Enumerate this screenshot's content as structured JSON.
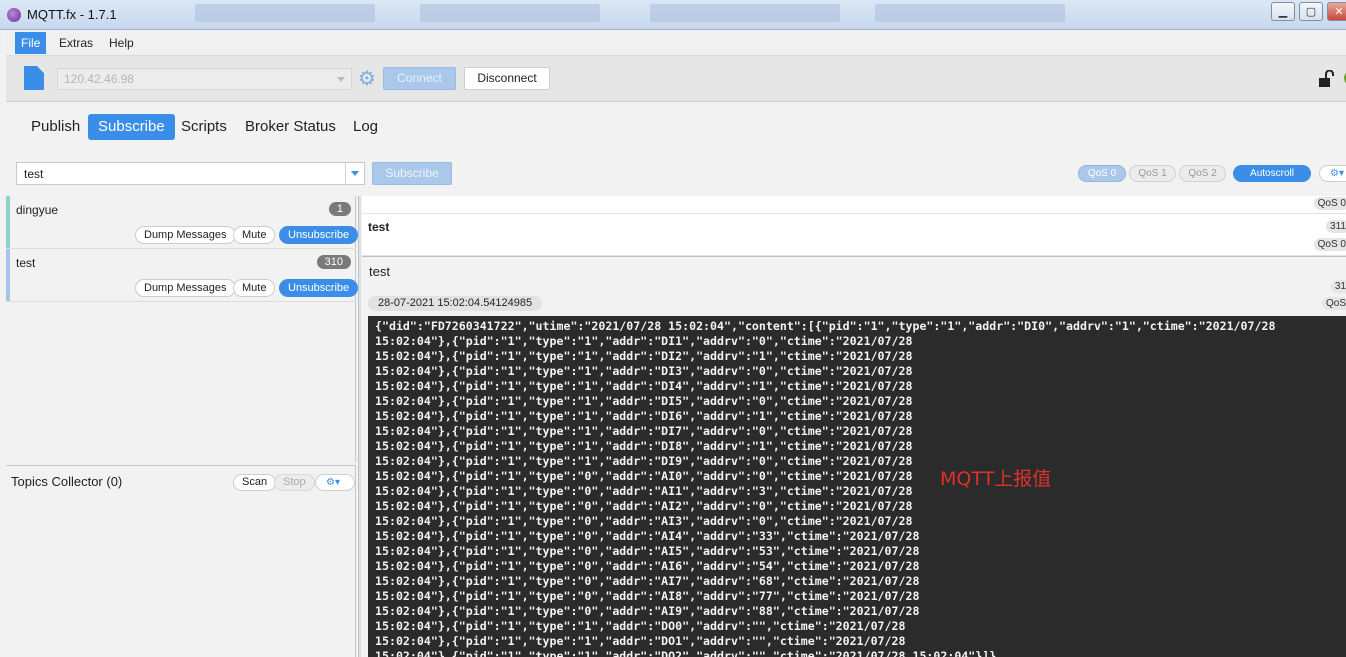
{
  "window": {
    "title": "MQTT.fx - 1.7.1"
  },
  "menu": {
    "items": [
      "File",
      "Extras",
      "Help"
    ]
  },
  "connection": {
    "broker": "120.42.46.98",
    "connect_label": "Connect",
    "disconnect_label": "Disconnect"
  },
  "tabs": [
    "Publish",
    "Subscribe",
    "Scripts",
    "Broker Status",
    "Log"
  ],
  "subscribe": {
    "topic_value": "test",
    "subscribe_label": "Subscribe",
    "qos": [
      "QoS 0",
      "QoS 1",
      "QoS 2"
    ],
    "autoscroll_label": "Autoscroll",
    "settings_icon": "⚙▾"
  },
  "subscriptions": [
    {
      "name": "dingyue",
      "count": "1",
      "color": "#8fd3c8"
    },
    {
      "name": "test",
      "count": "310",
      "color": "#a8c4ec"
    }
  ],
  "sub_buttons": {
    "dump": "Dump Messages",
    "mute": "Mute",
    "unsubscribe": "Unsubscribe"
  },
  "collector": {
    "label": "Topics Collector (0)",
    "scan": "Scan",
    "stop": "Stop",
    "settings_icon": "⚙▾"
  },
  "messages": [
    {
      "topic": "",
      "qos": "QoS 0"
    },
    {
      "topic": "test",
      "number": "311",
      "qos": "QoS 0"
    }
  ],
  "detail": {
    "topic": "test",
    "number": "31",
    "timestamp": "28-07-2021  15:02:04.54124985",
    "qos": "QoS",
    "payload_lines": [
      "{\"did\":\"FD7260341722\",\"utime\":\"2021/07/28 15:02:04\",\"content\":[{\"pid\":\"1\",\"type\":\"1\",\"addr\":\"DI0\",\"addrv\":\"1\",\"ctime\":\"2021/07/28",
      "15:02:04\"},{\"pid\":\"1\",\"type\":\"1\",\"addr\":\"DI1\",\"addrv\":\"0\",\"ctime\":\"2021/07/28",
      "15:02:04\"},{\"pid\":\"1\",\"type\":\"1\",\"addr\":\"DI2\",\"addrv\":\"1\",\"ctime\":\"2021/07/28",
      "15:02:04\"},{\"pid\":\"1\",\"type\":\"1\",\"addr\":\"DI3\",\"addrv\":\"0\",\"ctime\":\"2021/07/28",
      "15:02:04\"},{\"pid\":\"1\",\"type\":\"1\",\"addr\":\"DI4\",\"addrv\":\"1\",\"ctime\":\"2021/07/28",
      "15:02:04\"},{\"pid\":\"1\",\"type\":\"1\",\"addr\":\"DI5\",\"addrv\":\"0\",\"ctime\":\"2021/07/28",
      "15:02:04\"},{\"pid\":\"1\",\"type\":\"1\",\"addr\":\"DI6\",\"addrv\":\"1\",\"ctime\":\"2021/07/28",
      "15:02:04\"},{\"pid\":\"1\",\"type\":\"1\",\"addr\":\"DI7\",\"addrv\":\"0\",\"ctime\":\"2021/07/28",
      "15:02:04\"},{\"pid\":\"1\",\"type\":\"1\",\"addr\":\"DI8\",\"addrv\":\"1\",\"ctime\":\"2021/07/28",
      "15:02:04\"},{\"pid\":\"1\",\"type\":\"1\",\"addr\":\"DI9\",\"addrv\":\"0\",\"ctime\":\"2021/07/28",
      "15:02:04\"},{\"pid\":\"1\",\"type\":\"0\",\"addr\":\"AI0\",\"addrv\":\"0\",\"ctime\":\"2021/07/28",
      "15:02:04\"},{\"pid\":\"1\",\"type\":\"0\",\"addr\":\"AI1\",\"addrv\":\"3\",\"ctime\":\"2021/07/28",
      "15:02:04\"},{\"pid\":\"1\",\"type\":\"0\",\"addr\":\"AI2\",\"addrv\":\"0\",\"ctime\":\"2021/07/28",
      "15:02:04\"},{\"pid\":\"1\",\"type\":\"0\",\"addr\":\"AI3\",\"addrv\":\"0\",\"ctime\":\"2021/07/28",
      "15:02:04\"},{\"pid\":\"1\",\"type\":\"0\",\"addr\":\"AI4\",\"addrv\":\"33\",\"ctime\":\"2021/07/28",
      "15:02:04\"},{\"pid\":\"1\",\"type\":\"0\",\"addr\":\"AI5\",\"addrv\":\"53\",\"ctime\":\"2021/07/28",
      "15:02:04\"},{\"pid\":\"1\",\"type\":\"0\",\"addr\":\"AI6\",\"addrv\":\"54\",\"ctime\":\"2021/07/28",
      "15:02:04\"},{\"pid\":\"1\",\"type\":\"0\",\"addr\":\"AI7\",\"addrv\":\"68\",\"ctime\":\"2021/07/28",
      "15:02:04\"},{\"pid\":\"1\",\"type\":\"0\",\"addr\":\"AI8\",\"addrv\":\"77\",\"ctime\":\"2021/07/28",
      "15:02:04\"},{\"pid\":\"1\",\"type\":\"0\",\"addr\":\"AI9\",\"addrv\":\"88\",\"ctime\":\"2021/07/28",
      "15:02:04\"},{\"pid\":\"1\",\"type\":\"1\",\"addr\":\"DO0\",\"addrv\":\"\",\"ctime\":\"2021/07/28",
      "15:02:04\"},{\"pid\":\"1\",\"type\":\"1\",\"addr\":\"DO1\",\"addrv\":\"\",\"ctime\":\"2021/07/28",
      "15:02:04\"},{\"pid\":\"1\",\"type\":\"1\",\"addr\":\"DO2\",\"addrv\":\"\",\"ctime\":\"2021/07/28 15:02:04\"}]}"
    ]
  },
  "annotation": "MQTT上报值",
  "colors": {
    "accent": "#3b8ee8",
    "payload_bg": "#2b2b2b",
    "annotation": "#e0302a"
  }
}
